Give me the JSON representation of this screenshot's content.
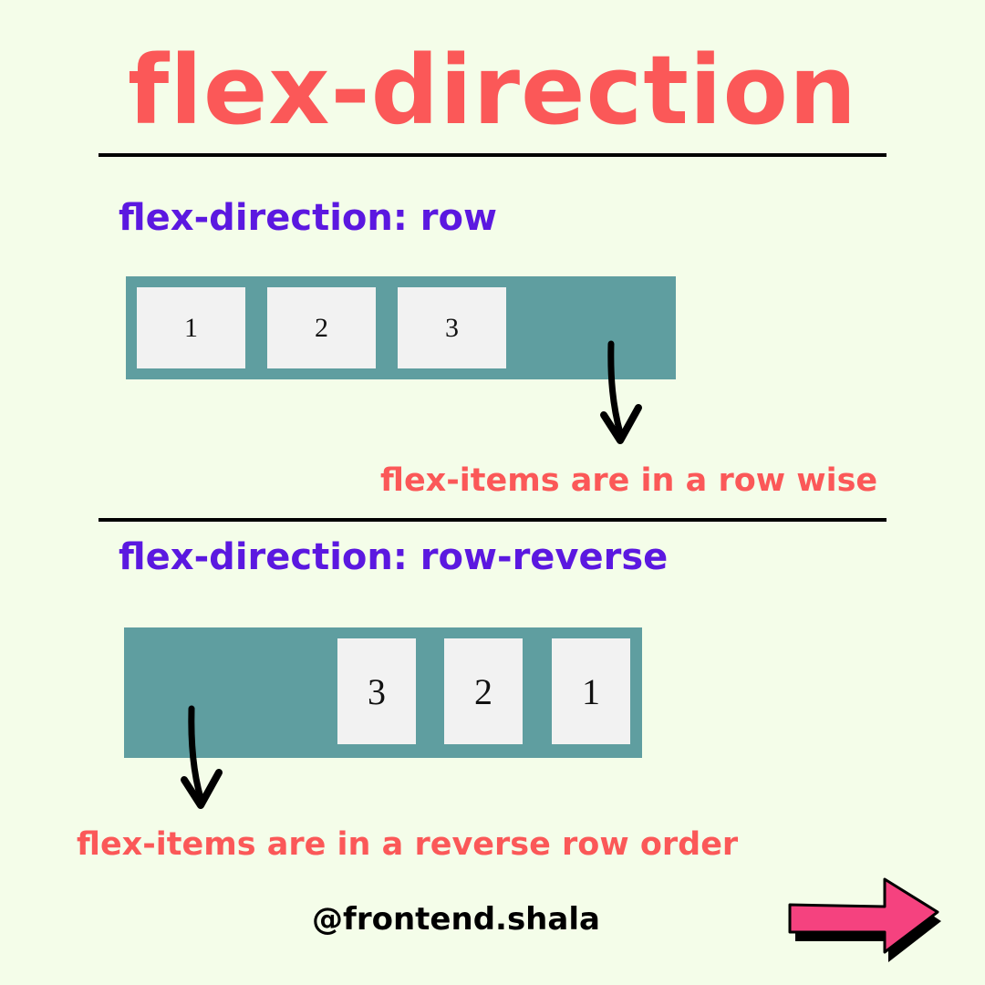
{
  "title": "flex-direction",
  "section_row": {
    "heading": "flex-direction: row",
    "items": [
      "1",
      "2",
      "3"
    ],
    "caption": "flex-items are in a row wise"
  },
  "section_row_reverse": {
    "heading": "flex-direction: row-reverse",
    "items": [
      "3",
      "2",
      "1"
    ],
    "caption": "flex-items are in a reverse row order"
  },
  "handle": "@frontend.shala",
  "colors": {
    "background": "#f4fde9",
    "title": "#fb5858",
    "heading": "#5b18e0",
    "container": "#5f9ea0",
    "item": "#f2f2f2",
    "next_arrow": "#f5427f"
  },
  "icons": {
    "pointer_row": "curved-arrow-down-icon",
    "pointer_row_reverse": "curved-arrow-down-icon",
    "next": "next-arrow-icon"
  }
}
